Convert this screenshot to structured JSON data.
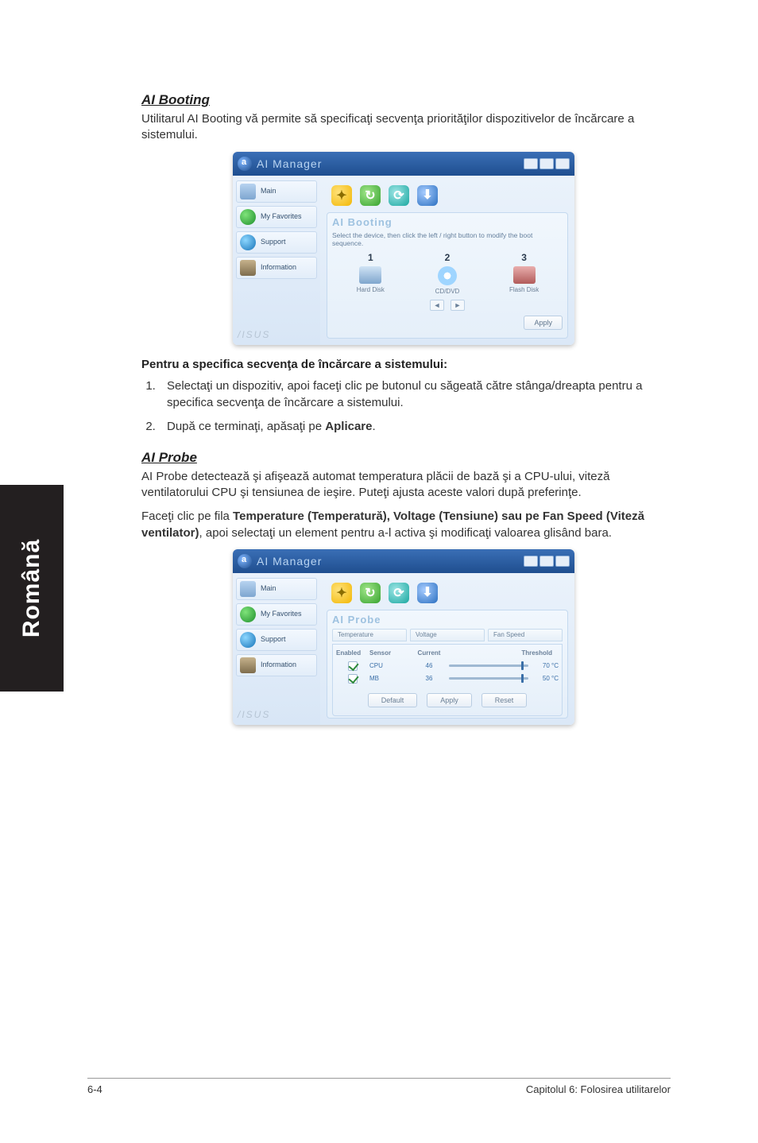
{
  "sideTab": "Română",
  "section1": {
    "heading": "AI Booting",
    "intro": "Utilitarul AI Booting vă permite să specificaţi secvenţa priorităţilor dispozitivelor de încărcare a sistemului.",
    "subhead": "Pentru a specifica secvenţa de încărcare a sistemului:",
    "steps": [
      "Selectaţi un dispozitiv, apoi faceţi clic pe butonul cu săgeată către stânga/dreapta pentru a specifica secvenţa de încărcare a sistemului.",
      "După ce terminaţi, apăsaţi pe "
    ],
    "step2bold": "Aplicare",
    "step2end": "."
  },
  "section2": {
    "heading": "AI Probe",
    "intro": "AI Probe detectează şi afişează automat temperatura plăcii de bază şi a CPU-ului, viteză ventilatorului CPU şi tensiunea de ieşire. Puteţi ajusta aceste valori după preferinţe.",
    "para2a": "Faceţi clic pe fila ",
    "para2bold": "Temperature (Temperatură), Voltage (Tensiune) sau pe Fan Speed (Viteză ventilator)",
    "para2b": ", apoi selectaţi un element pentru a-l activa şi modificaţi valoarea glisând bara."
  },
  "app": {
    "title": "AI Manager",
    "brand": "/ISUS",
    "sidebar": {
      "main": "Main",
      "favorites": "My Favorites",
      "support": "Support",
      "information": "Information"
    }
  },
  "bootPanel": {
    "title": "AI Booting",
    "sub": "Select the device, then click the left / right button to modify the boot sequence.",
    "nums": [
      "1",
      "2",
      "3"
    ],
    "devs": [
      "Hard Disk",
      "CD/DVD",
      "Flash Disk"
    ],
    "applyLabel": "Apply"
  },
  "probePanel": {
    "title": "AI Probe",
    "tabs": [
      "Temperature",
      "Voltage",
      "Fan Speed"
    ],
    "headers": {
      "enabled": "Enabled",
      "sensor": "Sensor",
      "current": "Current",
      "threshold": "Threshold"
    },
    "rows": [
      {
        "sensor": "CPU",
        "current": "46",
        "val": "70 °C"
      },
      {
        "sensor": "MB",
        "current": "36",
        "val": "50 °C"
      }
    ],
    "buttons": [
      "Default",
      "Apply",
      "Reset"
    ]
  },
  "footer": {
    "left": "6-4",
    "right": "Capitolul 6: Folosirea utilitarelor"
  }
}
